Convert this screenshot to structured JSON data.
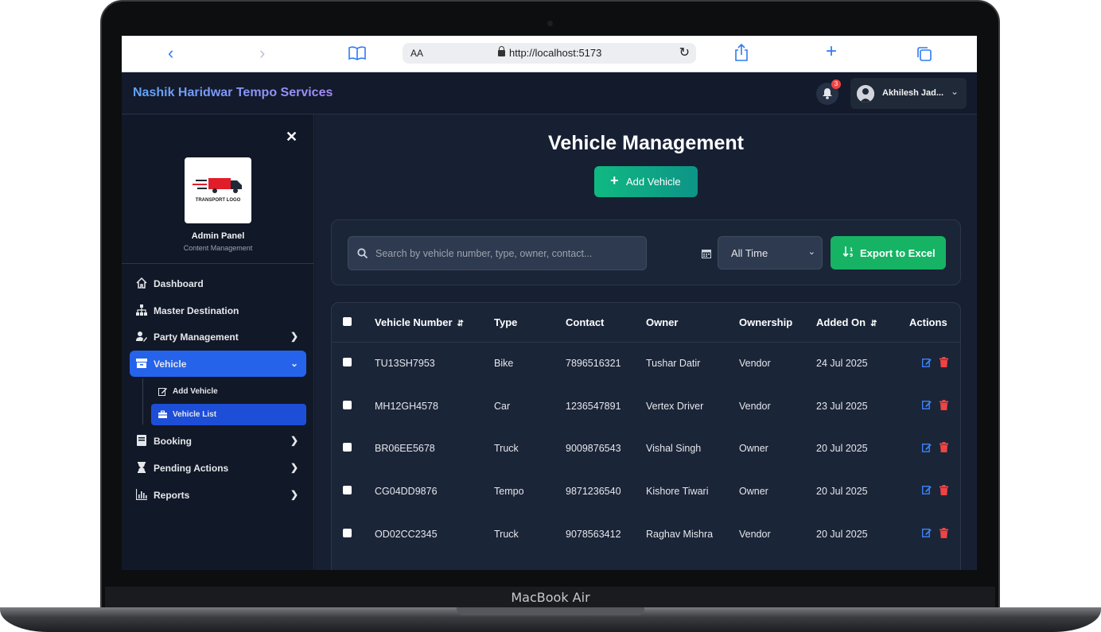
{
  "device": {
    "label": "MacBook Air"
  },
  "browser": {
    "text_size_label": "AA",
    "url": "http://localhost:5173"
  },
  "header": {
    "title": "Nashik Haridwar Tempo Services",
    "notification_count": "3",
    "user_name": "Akhilesh Jad..."
  },
  "sidebar": {
    "logo_text": "TRANSPORT LOGO",
    "panel_title": "Admin Panel",
    "panel_subtitle": "Content Management",
    "items": [
      {
        "label": "Dashboard",
        "icon": "home-icon"
      },
      {
        "label": "Master Destination",
        "icon": "sitemap-icon"
      },
      {
        "label": "Party Management",
        "icon": "user-edit-icon"
      },
      {
        "label": "Vehicle",
        "icon": "archive-icon"
      },
      {
        "label": "Booking",
        "icon": "book-icon"
      },
      {
        "label": "Pending Actions",
        "icon": "hourglass-icon"
      },
      {
        "label": "Reports",
        "icon": "bar-chart-icon"
      }
    ],
    "vehicle_sub": [
      {
        "label": "Add Vehicle",
        "icon": "edit-icon"
      },
      {
        "label": "Vehicle List",
        "icon": "briefcase-icon"
      }
    ]
  },
  "main": {
    "title": "Vehicle Management",
    "add_button": "Add Vehicle",
    "search_placeholder": "Search by vehicle number, type, owner, contact...",
    "time_filter": "All Time",
    "export_button": "Export to Excel",
    "columns": [
      "Vehicle Number",
      "Type",
      "Contact",
      "Owner",
      "Ownership",
      "Added On",
      "Actions"
    ],
    "rows": [
      {
        "number": "TU13SH7953",
        "type": "Bike",
        "contact": "7896516321",
        "owner": "Tushar Datir",
        "ownership": "Vendor",
        "added": "24 Jul 2025"
      },
      {
        "number": "MH12GH4578",
        "type": "Car",
        "contact": "1236547891",
        "owner": "Vertex Driver",
        "ownership": "Vendor",
        "added": "23 Jul 2025"
      },
      {
        "number": "BR06EE5678",
        "type": "Truck",
        "contact": "9009876543",
        "owner": "Vishal Singh",
        "ownership": "Owner",
        "added": "20 Jul 2025"
      },
      {
        "number": "CG04DD9876",
        "type": "Tempo",
        "contact": "9871236540",
        "owner": "Kishore Tiwari",
        "ownership": "Owner",
        "added": "20 Jul 2025"
      },
      {
        "number": "OD02CC2345",
        "type": "Truck",
        "contact": "9078563412",
        "owner": "Raghav Mishra",
        "ownership": "Vendor",
        "added": "20 Jul 2025"
      }
    ]
  },
  "colors": {
    "accent": "#2563eb",
    "success": "#16b364",
    "danger": "#ef4444",
    "edit": "#3b82f6"
  }
}
